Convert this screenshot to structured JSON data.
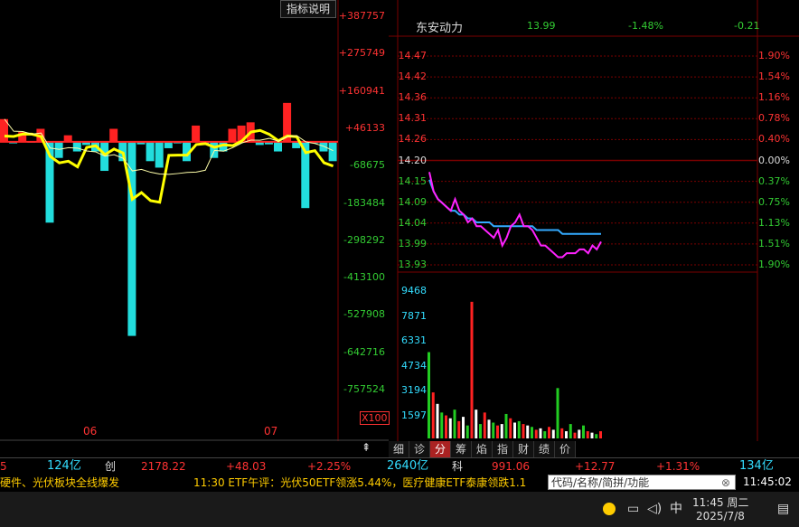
{
  "colors": {
    "rise": "#ff2222",
    "fall": "#22dddd",
    "flat": "#ffffff",
    "yellow": "#ffff00",
    "magenta": "#ff22ff",
    "avgline": "#33aaff",
    "grid": "#7a0000",
    "green_vol": "#22cc22"
  },
  "left_panel": {
    "indicator_button": "指标说明",
    "y_axis": [
      "+387757",
      "+275749",
      "+160941",
      "+46133",
      "-68675",
      "-183484",
      "-298292",
      "-413100",
      "-527908",
      "-642716",
      "-757524"
    ],
    "x_labels": [
      "06",
      "07"
    ],
    "unit_label": "X100"
  },
  "chart_data": [
    {
      "type": "bar",
      "x": [
        1,
        2,
        3,
        4,
        5,
        6,
        7,
        8,
        9,
        10,
        11,
        12,
        13,
        14,
        15,
        16,
        17,
        18,
        19,
        20,
        21,
        22,
        23,
        24,
        25,
        26,
        27,
        28,
        29,
        30,
        31,
        32,
        33,
        34,
        35,
        36,
        37
      ],
      "values": [
        70000,
        -5000,
        30000,
        -1000,
        40000,
        -250000,
        -50000,
        20000,
        -30000,
        -10000,
        -30000,
        -90000,
        40000,
        -60000,
        -600000,
        -8000,
        -60000,
        -80000,
        -20000,
        -5000,
        -60000,
        50000,
        -8000,
        -50000,
        -30000,
        40000,
        50000,
        60000,
        -10000,
        -8000,
        -30000,
        120000,
        -20000,
        -205000,
        -5000,
        -30000,
        -60000
      ],
      "ylim": [
        -757524,
        387757
      ]
    },
    {
      "type": "line",
      "ylim": [
        13.93,
        14.47
      ],
      "y_ticks": [
        "14.47",
        "14.42",
        "14.36",
        "14.31",
        "14.26",
        "14.20",
        "14.15",
        "14.09",
        "14.04",
        "13.99",
        "13.93"
      ],
      "pct_ticks": [
        "1.90%",
        "1.54%",
        "1.16%",
        "0.78%",
        "0.40%",
        "0.00%",
        "0.37%",
        "0.75%",
        "1.13%",
        "1.51%",
        "1.90%"
      ],
      "series": [
        {
          "values": [
            14.17,
            14.12,
            14.1,
            14.09,
            14.08,
            14.07,
            14.1,
            14.07,
            14.06,
            14.04,
            14.05,
            14.03,
            14.03,
            14.02,
            14.01,
            14.0,
            14.02,
            13.98,
            14.0,
            14.03,
            14.04,
            14.06,
            14.03,
            14.03,
            14.02,
            14.0,
            13.98,
            13.98,
            13.97,
            13.96,
            13.95,
            13.95,
            13.96,
            13.96,
            13.96,
            13.97,
            13.97,
            13.96,
            13.98,
            13.97,
            13.99
          ]
        },
        {
          "values": [
            14.15,
            14.12,
            14.1,
            14.09,
            14.08,
            14.07,
            14.07,
            14.06,
            14.06,
            14.05,
            14.05,
            14.04,
            14.04,
            14.04,
            14.04,
            14.03,
            14.03,
            14.03,
            14.03,
            14.03,
            14.03,
            14.03,
            14.03,
            14.03,
            14.03,
            14.02,
            14.02,
            14.02,
            14.02,
            14.02,
            14.02,
            14.01,
            14.01,
            14.01,
            14.01,
            14.01,
            14.01,
            14.01,
            14.01,
            14.01,
            14.01
          ]
        }
      ]
    },
    {
      "type": "bar",
      "ylim": [
        0,
        11000
      ],
      "y_ticks": [
        "9468",
        "7871",
        "6331",
        "4734",
        "3194",
        "1597"
      ],
      "values": [
        6000,
        3200,
        2400,
        1800,
        1600,
        1400,
        2000,
        1200,
        1500,
        900,
        9500,
        2000,
        1000,
        1800,
        1300,
        1100,
        900,
        1000,
        1700,
        1400,
        1100,
        1200,
        1000,
        900,
        800,
        600,
        700,
        500,
        800,
        600,
        3500,
        700,
        500,
        1000,
        400,
        600,
        900,
        500,
        400,
        300,
        500
      ]
    }
  ],
  "right_panel": {
    "stock_name": "东安动力",
    "price": "13.99",
    "change_pct": "-1.48%",
    "change": "-0.21",
    "tabs": [
      "细",
      "诊",
      "分",
      "筹",
      "焰",
      "指",
      "财",
      "绩",
      "价"
    ],
    "active_tab": "分"
  },
  "status_bar": {
    "s1": "5",
    "s2": "124亿",
    "s3": "创",
    "s4": "2178.22",
    "s5": "+48.03",
    "s6": "+2.25%",
    "s7": "2640亿",
    "s8": "科",
    "s9": "991.06",
    "s10": "+12.77",
    "s11": "+1.31%",
    "s12": "134亿"
  },
  "ticker": {
    "news1": "硬件、光伏板块全线爆发",
    "news2": "11:30 ETF午评：光伏50ETF领涨5.44%，医疗健康ETF泰康领跌1.1",
    "search_placeholder": "代码/名称/简拼/功能",
    "time": "11:45:02"
  },
  "taskbar": {
    "ime": "中",
    "time": "11:45 周二",
    "date": "2025/7/8"
  }
}
